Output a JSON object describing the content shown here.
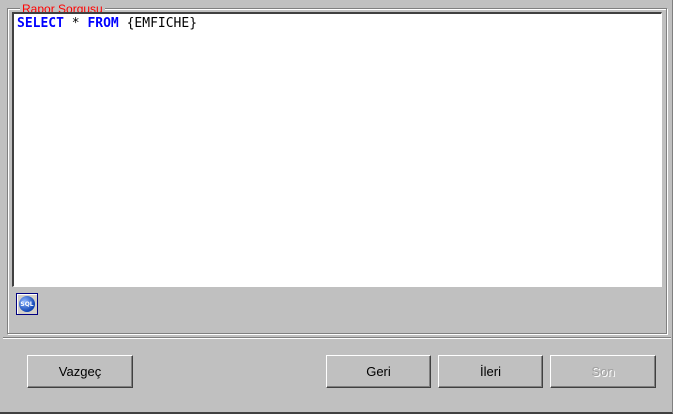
{
  "group": {
    "title": "Rapor Sorgusu"
  },
  "editor": {
    "kw_select": "SELECT",
    "star": "*",
    "kw_from": "FROM",
    "table": "{EMFICHE}"
  },
  "sql_button": {
    "icon_text": "SQL",
    "icon": "sql-icon"
  },
  "buttons": {
    "cancel": "Vazgeç",
    "back": "Geri",
    "next": "İleri",
    "finish": "Son"
  },
  "colors": {
    "legend": "#ff0000",
    "keyword": "#0000ff",
    "background": "#c0c0c0"
  }
}
